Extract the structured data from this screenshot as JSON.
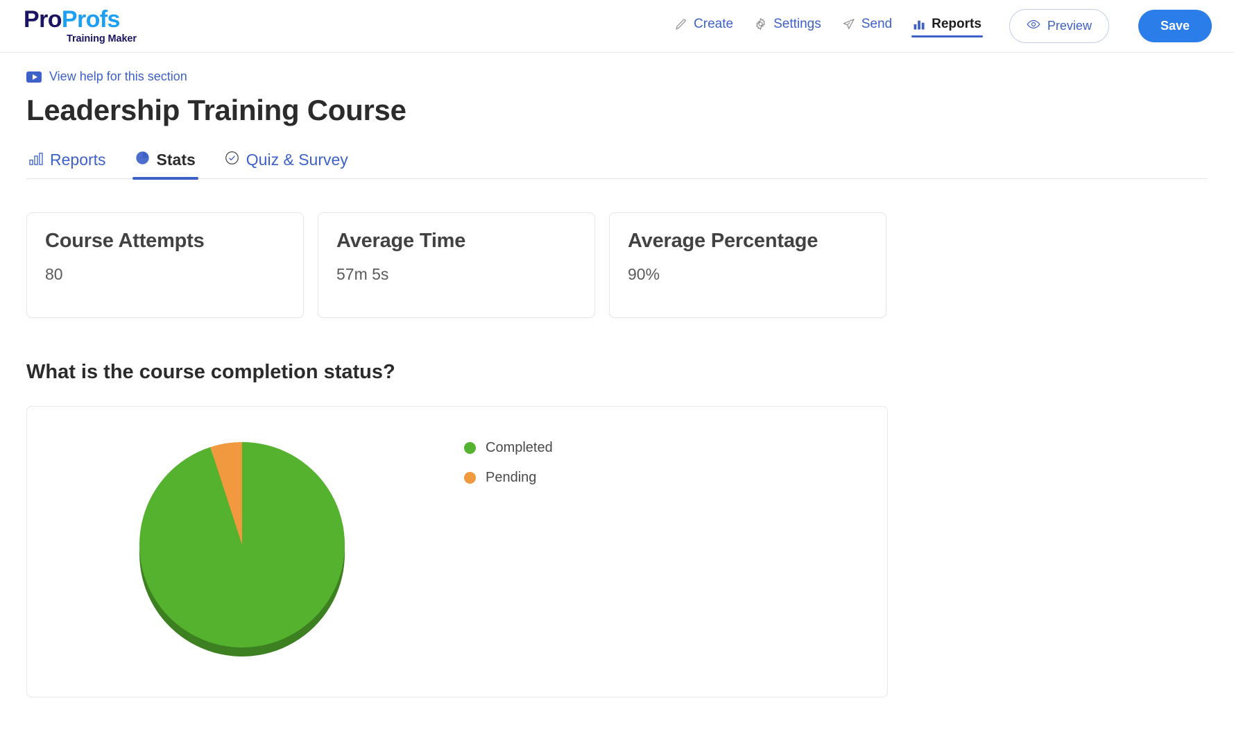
{
  "header": {
    "logo": {
      "part1": "Pro",
      "part2": "Profs",
      "subtitle": "Training Maker"
    },
    "nav": [
      {
        "label": "Create",
        "icon": "pencil-icon",
        "active": false
      },
      {
        "label": "Settings",
        "icon": "gear-icon",
        "active": false
      },
      {
        "label": "Send",
        "icon": "paper-plane-icon",
        "active": false
      },
      {
        "label": "Reports",
        "icon": "bar-chart-icon",
        "active": true
      }
    ],
    "preview_label": "Preview",
    "save_label": "Save"
  },
  "help": {
    "label": "View help for this section",
    "icon": "video-play-icon"
  },
  "page": {
    "title": "Leadership Training Course"
  },
  "tabs": [
    {
      "label": "Reports",
      "icon": "bar-chart-icon",
      "active": false
    },
    {
      "label": "Stats",
      "icon": "pie-chart-icon",
      "active": true
    },
    {
      "label": "Quiz & Survey",
      "icon": "check-circle-icon",
      "active": false
    }
  ],
  "cards": [
    {
      "title": "Course Attempts",
      "value": "80"
    },
    {
      "title": "Average Time",
      "value": "57m 5s"
    },
    {
      "title": "Average Percentage",
      "value": "90%"
    }
  ],
  "question": "What is the course completion status?",
  "chart_data": {
    "type": "pie",
    "title": "What is the course completion status?",
    "labels": [
      "Completed",
      "Pending"
    ],
    "values": [
      95,
      5
    ],
    "colors": [
      "#55b22e",
      "#f0993e"
    ],
    "legend_position": "right",
    "start_angle": 0,
    "three_d": true
  },
  "colors": {
    "accent_blue": "#3e61c9",
    "save_blue": "#2b7de9",
    "logo_navy": "#1b1464",
    "logo_cyan": "#1e9ff2",
    "completed_green": "#55b22e",
    "pending_orange": "#f0993e"
  }
}
